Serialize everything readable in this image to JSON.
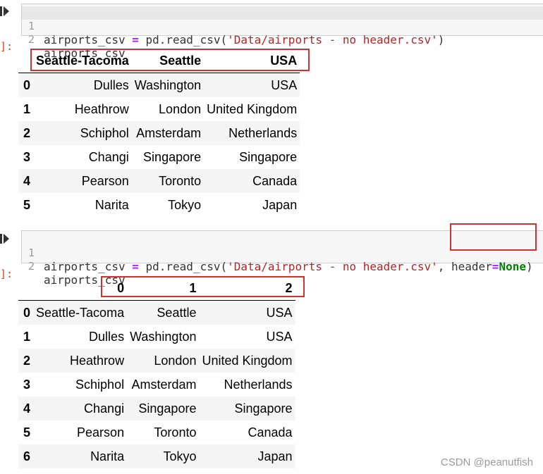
{
  "cell1": {
    "line_numbers": [
      "1",
      "2"
    ],
    "code_line1": {
      "var": "airports_csv ",
      "op": "=",
      "mid": " pd.read_csv(",
      "str": "'Data/airports - no header.csv'",
      "end": ")"
    },
    "code_line2": "airports_csv",
    "out_prompt": "]:",
    "table": {
      "columns": [
        "Seattle-Tacoma",
        "Seattle",
        "USA"
      ],
      "rows": [
        {
          "idx": "0",
          "cells": [
            "Dulles",
            "Washington",
            "USA"
          ]
        },
        {
          "idx": "1",
          "cells": [
            "Heathrow",
            "London",
            "United Kingdom"
          ]
        },
        {
          "idx": "2",
          "cells": [
            "Schiphol",
            "Amsterdam",
            "Netherlands"
          ]
        },
        {
          "idx": "3",
          "cells": [
            "Changi",
            "Singapore",
            "Singapore"
          ]
        },
        {
          "idx": "4",
          "cells": [
            "Pearson",
            "Toronto",
            "Canada"
          ]
        },
        {
          "idx": "5",
          "cells": [
            "Narita",
            "Tokyo",
            "Japan"
          ]
        }
      ]
    }
  },
  "cell2": {
    "line_numbers": [
      "1",
      "2"
    ],
    "code_line1": {
      "var": "airports_csv ",
      "op": "=",
      "mid": " pd.read_csv(",
      "str": "'Data/airports - no header.csv'",
      "comma": ", ",
      "kwarg": "header",
      "eq": "=",
      "none": "None",
      "end": ")"
    },
    "code_line2": "airports_csv",
    "out_prompt": "]:",
    "table": {
      "columns": [
        "0",
        "1",
        "2"
      ],
      "rows": [
        {
          "idx": "0",
          "cells": [
            "Seattle-Tacoma",
            "Seattle",
            "USA"
          ]
        },
        {
          "idx": "1",
          "cells": [
            "Dulles",
            "Washington",
            "USA"
          ]
        },
        {
          "idx": "2",
          "cells": [
            "Heathrow",
            "London",
            "United Kingdom"
          ]
        },
        {
          "idx": "3",
          "cells": [
            "Schiphol",
            "Amsterdam",
            "Netherlands"
          ]
        },
        {
          "idx": "4",
          "cells": [
            "Changi",
            "Singapore",
            "Singapore"
          ]
        },
        {
          "idx": "5",
          "cells": [
            "Pearson",
            "Toronto",
            "Canada"
          ]
        },
        {
          "idx": "6",
          "cells": [
            "Narita",
            "Tokyo",
            "Japan"
          ]
        }
      ]
    }
  },
  "watermark": "CSDN @peanutfish",
  "colors": {
    "highlight_box": "#d0312d",
    "string": "#ba2121",
    "operator": "#aa22ff",
    "keyword": "#008000"
  }
}
